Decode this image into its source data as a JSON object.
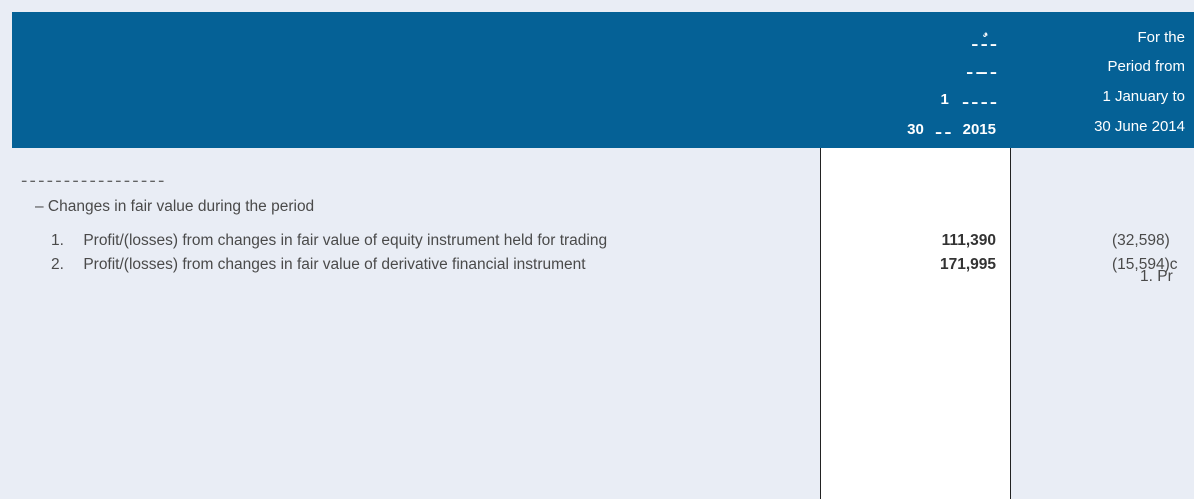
{
  "header": {
    "current_period": {
      "line1": "ـ ـٌ ـ",
      "line2": "ـ ــ ـ",
      "line3_number": "1",
      "line3_text": "ـ ـ ـ ـ",
      "line4_day": "30",
      "line4_month": "ـ ـ",
      "line4_year": "2015"
    },
    "prior_period": {
      "line1": "For the",
      "line2": "Period from",
      "line3": "1 January to",
      "line4": "30 June 2014"
    }
  },
  "section": {
    "heading": "ـ ـ ـ ـ ـ ـ ـ ـ ـ ـ ـ ـ ـ ـ ـ ـ ـ",
    "sub_heading": "– Changes in fair value during the period"
  },
  "rows": [
    {
      "index": "1.",
      "label": "Profit/(losses) from changes in fair value of equity instrument held for trading",
      "current": "111,390",
      "prior": "(32,598)"
    },
    {
      "index": "2.",
      "label": "Profit/(losses) from changes in fair value of derivative financial instrument",
      "current": "171,995",
      "prior": "(15,594)c"
    }
  ],
  "overflow_text": "1. Pr"
}
